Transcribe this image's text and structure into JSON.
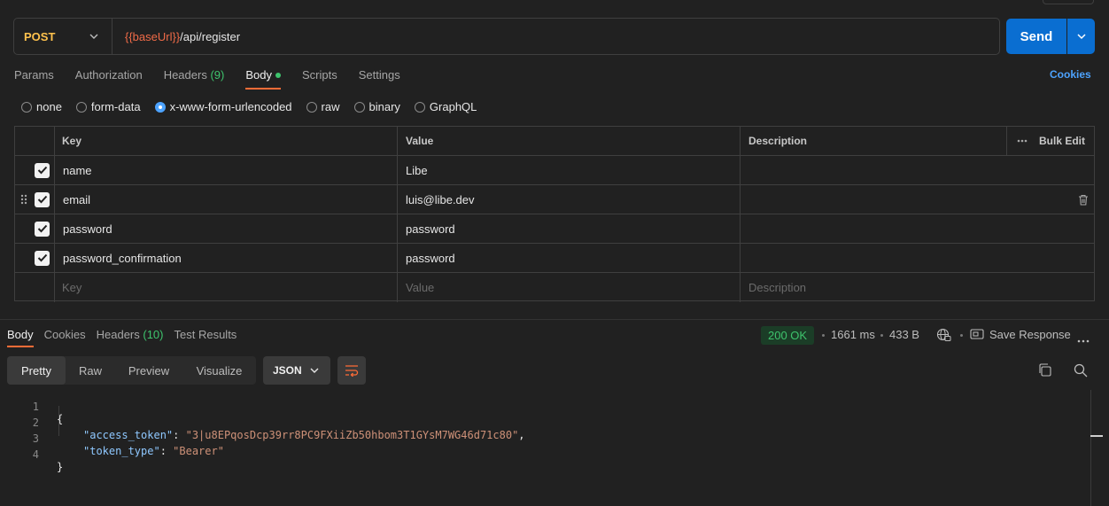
{
  "request": {
    "method": "POST",
    "url_var": "{{baseUrl}}",
    "url_path": "/api/register",
    "send_label": "Send"
  },
  "request_tabs": [
    {
      "label": "Params"
    },
    {
      "label": "Authorization"
    },
    {
      "label": "Headers",
      "count": "(9)"
    },
    {
      "label": "Body",
      "active": true
    },
    {
      "label": "Scripts"
    },
    {
      "label": "Settings"
    }
  ],
  "cookies_link": "Cookies",
  "body_types": [
    "none",
    "form-data",
    "x-www-form-urlencoded",
    "raw",
    "binary",
    "GraphQL"
  ],
  "body_type_selected": "x-www-form-urlencoded",
  "table": {
    "headers": {
      "key": "Key",
      "value": "Value",
      "description": "Description",
      "bulk_edit": "Bulk Edit"
    },
    "rows": [
      {
        "key": "name",
        "value": "Libe",
        "checked": true
      },
      {
        "key": "email",
        "value": "luis@libe.dev",
        "checked": true
      },
      {
        "key": "password",
        "value": "password",
        "checked": true
      },
      {
        "key": "password_confirmation",
        "value": "password",
        "checked": true
      }
    ],
    "placeholder": {
      "key": "Key",
      "value": "Value",
      "description": "Description"
    }
  },
  "response": {
    "tabs": [
      {
        "label": "Body",
        "active": true
      },
      {
        "label": "Cookies"
      },
      {
        "label": "Headers",
        "count": "(10)"
      },
      {
        "label": "Test Results"
      }
    ],
    "status": "200 OK",
    "time": "1661 ms",
    "size": "433 B",
    "save_label": "Save Response",
    "formats": [
      "Pretty",
      "Raw",
      "Preview",
      "Visualize"
    ],
    "format_active": "Pretty",
    "language": "JSON",
    "code_lines": [
      {
        "num": "1",
        "text": "{"
      },
      {
        "num": "2",
        "key": "\"access_token\"",
        "value": "\"3|u8EPqosDcp39rr8PC9FXiiZb50hbom3T1GYsM7WG46d71c80\"",
        "trail": ","
      },
      {
        "num": "3",
        "key": "\"token_type\"",
        "value": "\"Bearer\"",
        "trail": ""
      },
      {
        "num": "4",
        "text": "}"
      }
    ]
  }
}
